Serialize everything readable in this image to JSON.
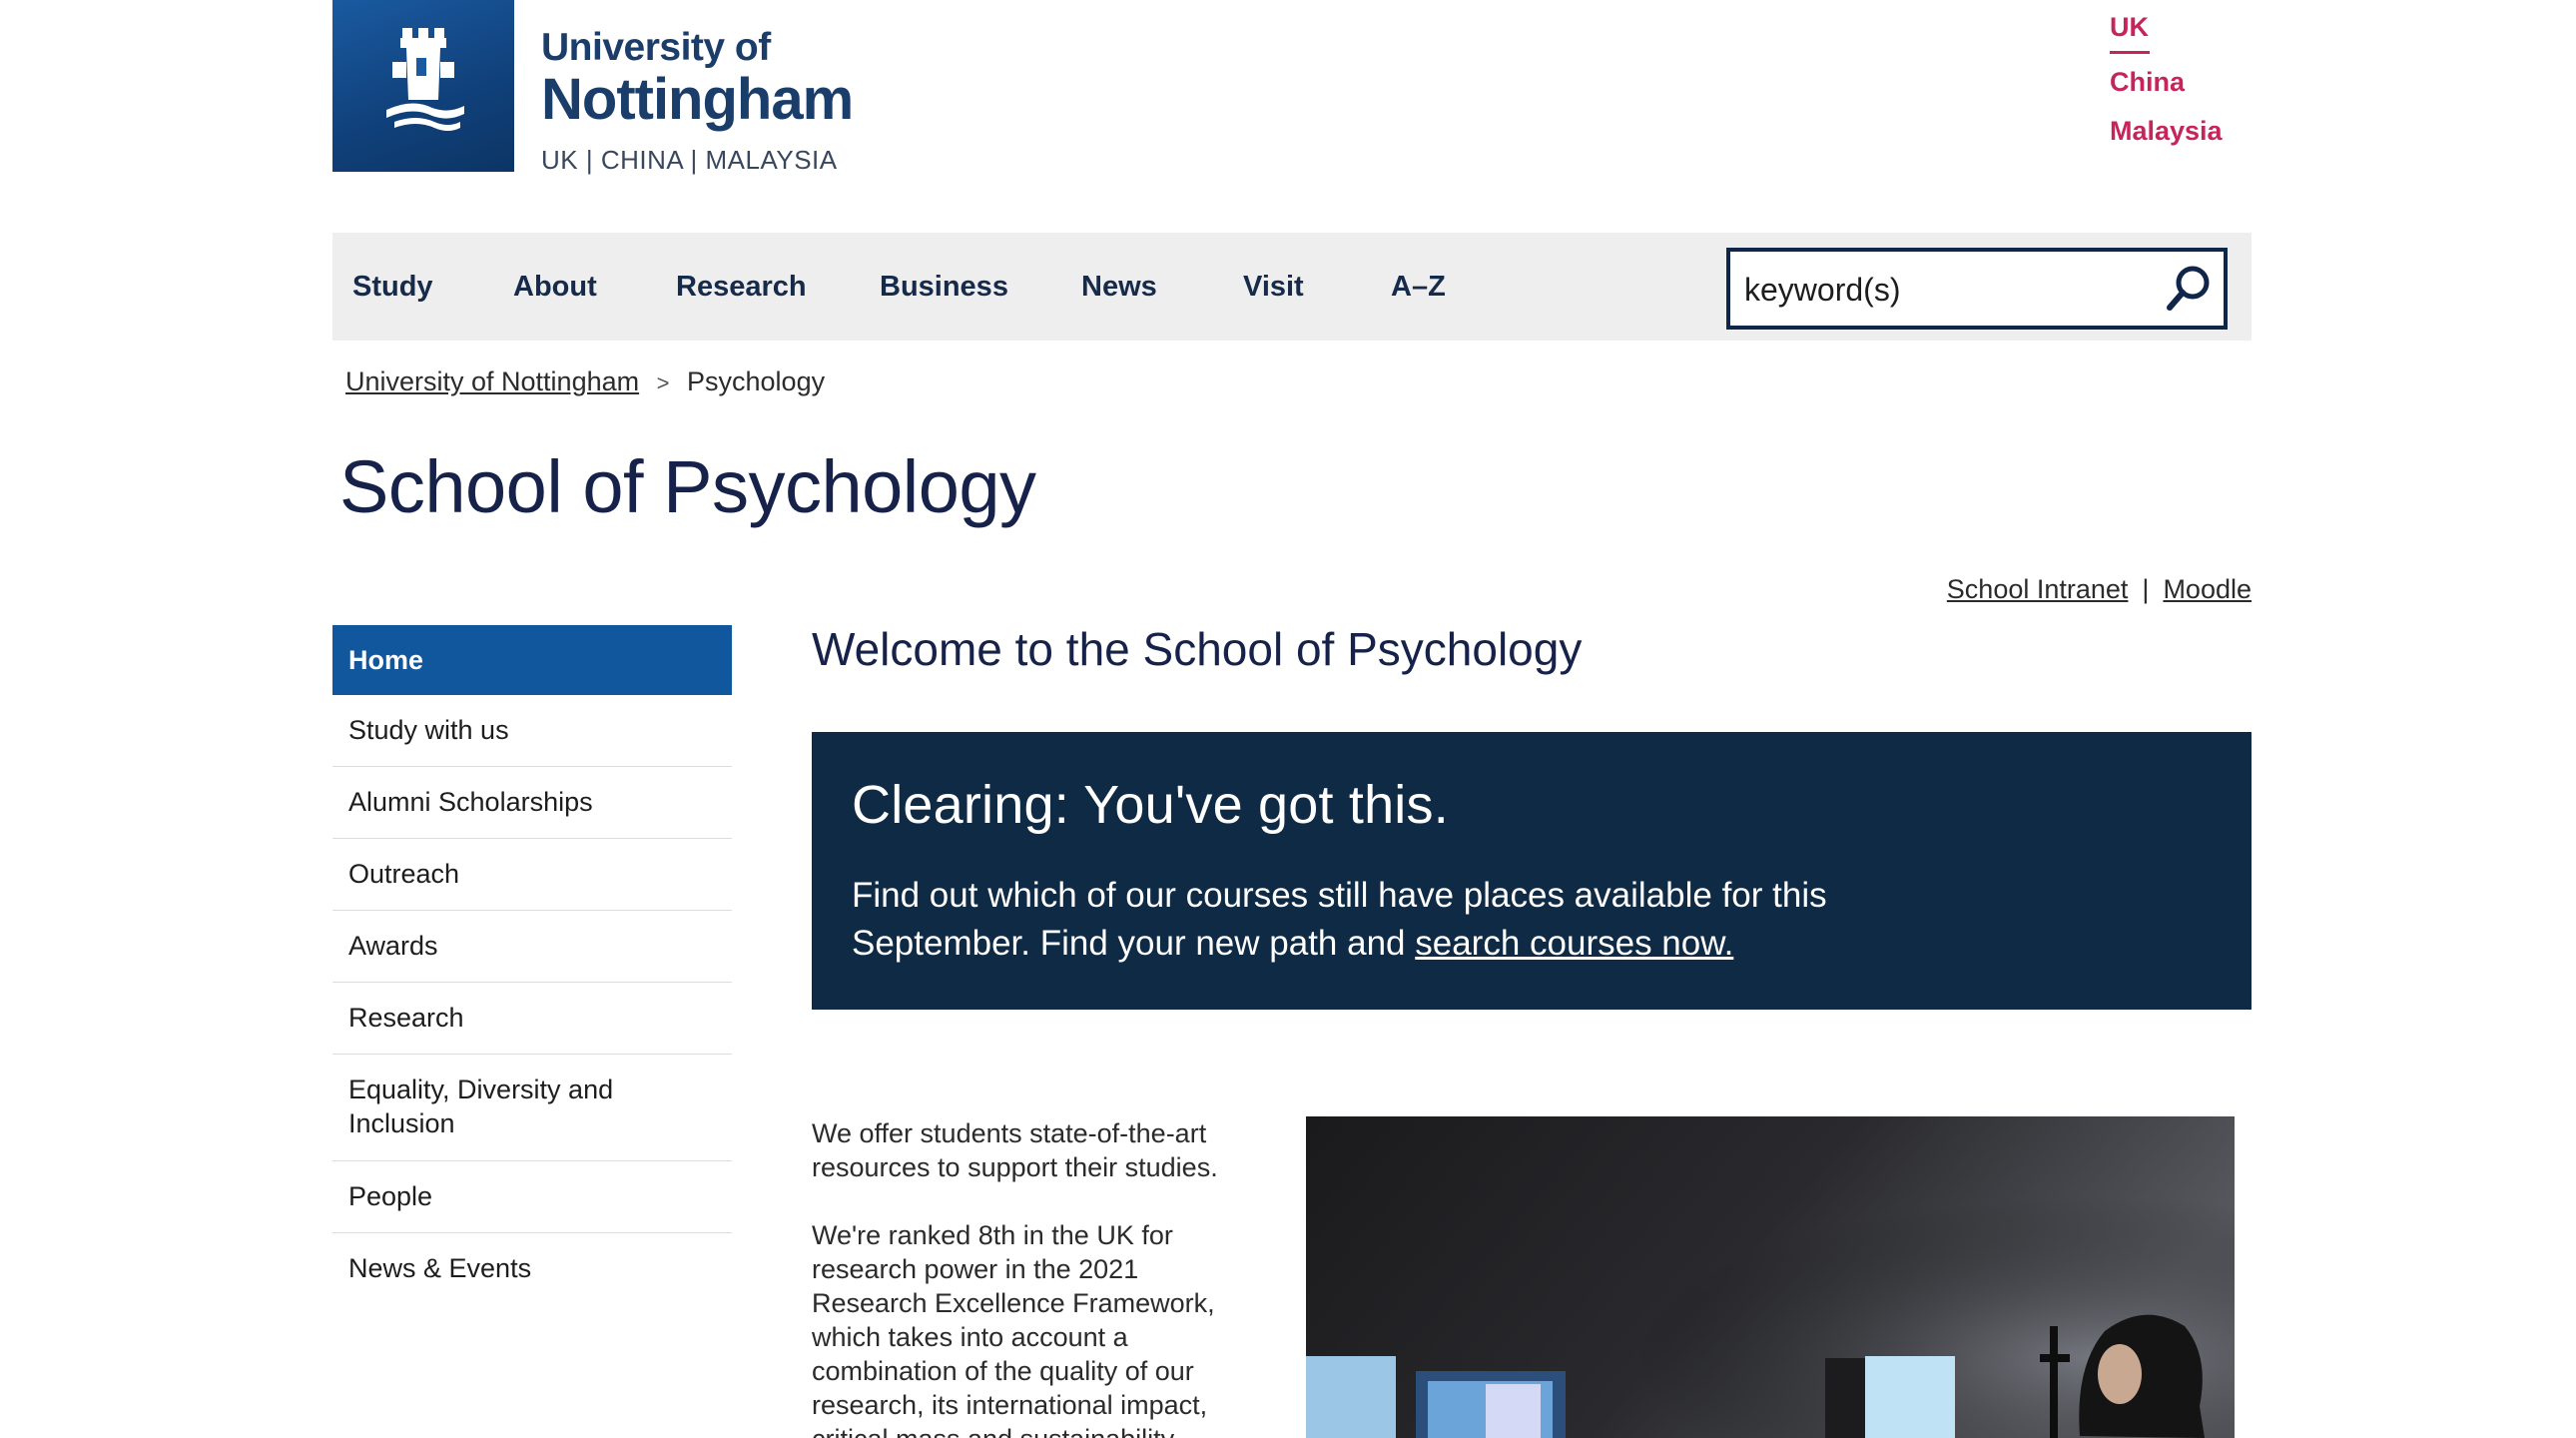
{
  "header": {
    "logo_line1": "University of",
    "logo_line2": "Nottingham",
    "logo_line3": "UK | CHINA | MALAYSIA",
    "campuses": [
      "UK",
      "China",
      "Malaysia"
    ]
  },
  "nav": {
    "items": [
      "Study",
      "About",
      "Research",
      "Business",
      "News",
      "Visit",
      "A–Z"
    ],
    "search_placeholder": "keyword(s)"
  },
  "breadcrumb": {
    "home": "University of Nottingham",
    "separator": ">",
    "current": "Psychology"
  },
  "page_title": "School of Psychology",
  "util_links": {
    "intranet": "School Intranet",
    "separator": "|",
    "moodle": "Moodle"
  },
  "sidebar": {
    "items": [
      "Home",
      "Study with us",
      "Alumni Scholarships",
      "Outreach",
      "Awards",
      "Research",
      "Equality, Diversity and Inclusion",
      "People",
      "News & Events"
    ]
  },
  "main": {
    "welcome": "Welcome to the School of Psychology",
    "clearing_title": "Clearing: You've got this.",
    "clearing_text": "Find out which of our courses still have places available for this September. Find your new path and ",
    "clearing_link": "search courses now.",
    "intro_p1": "We offer students state-of-the-art resources to support their studies.",
    "intro_p2": "We're ranked 8th in the UK for research power in the 2021 Research Excellence Framework, which takes into account a combination of the quality of our research, its international impact, critical mass and sustainability."
  },
  "colors": {
    "brand_blue": "#10579e",
    "navy": "#0f2a45",
    "campus_pink": "#c7245c",
    "nav_bg": "#eeeeee"
  }
}
